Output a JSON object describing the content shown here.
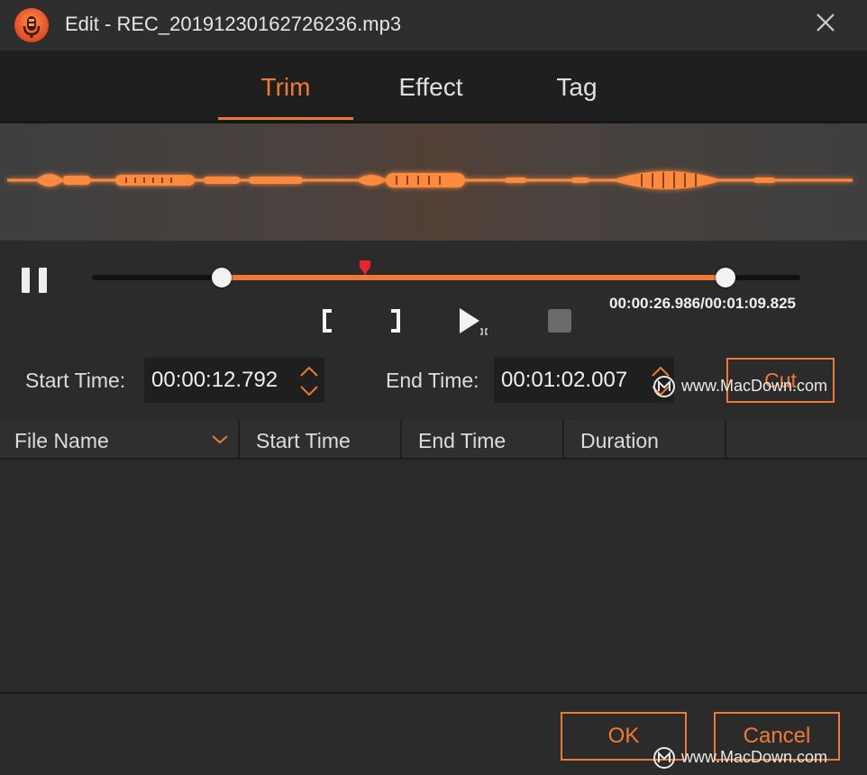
{
  "window": {
    "title": "Edit - REC_20191230162726236.mp3",
    "logo_icon": "record-app-icon",
    "close_icon": "close-icon"
  },
  "tabs": [
    {
      "label": "Trim",
      "active": true
    },
    {
      "label": "Effect",
      "active": false
    },
    {
      "label": "Tag",
      "active": false
    }
  ],
  "player": {
    "time_readout": "00:00:26.986/00:01:09.825",
    "current_time": "00:00:26.986",
    "total_time": "00:01:09.825",
    "trim_start_fraction": 0.183,
    "trim_end_fraction": 0.894,
    "playhead_fraction": 0.386
  },
  "trim": {
    "start_label": "Start Time:",
    "start_value": "00:00:12.792",
    "end_label": "End Time:",
    "end_value": "00:01:02.007",
    "cut_label": "Cut"
  },
  "table": {
    "columns": [
      "File Name",
      "Start Time",
      "End Time",
      "Duration"
    ],
    "rows": []
  },
  "footer": {
    "ok_label": "OK",
    "cancel_label": "Cancel"
  },
  "watermark": {
    "text": "www.MacDown.com"
  },
  "colors": {
    "accent": "#ef7a33",
    "background": "#2b2b2b",
    "tab_bar": "#1f1f1f",
    "text": "#dcdcdc"
  }
}
